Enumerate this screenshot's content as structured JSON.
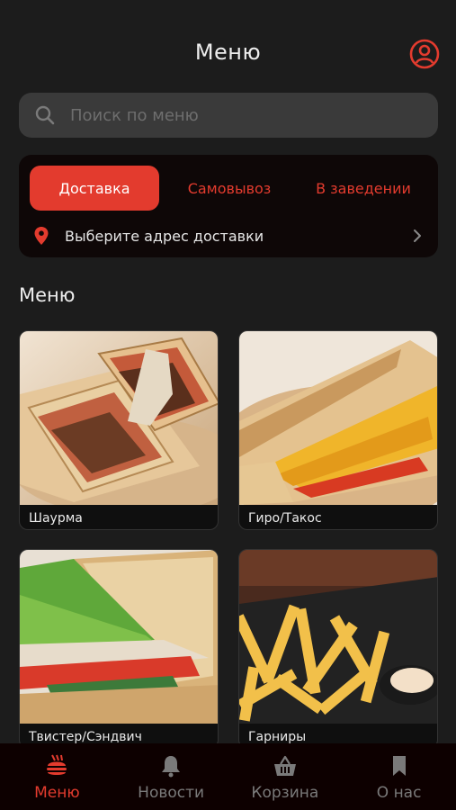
{
  "header": {
    "title": "Меню",
    "profile_icon": "user-circle-icon"
  },
  "search": {
    "placeholder": "Поиск по меню",
    "icon": "search-icon"
  },
  "order_modes": {
    "tabs": [
      {
        "label": "Доставка",
        "active": true
      },
      {
        "label": "Самовывоз",
        "active": false
      },
      {
        "label": "В заведении",
        "active": false
      }
    ],
    "address_prompt": "Выберите адрес доставки"
  },
  "menu": {
    "title": "Меню",
    "categories": [
      {
        "label": "Шаурма"
      },
      {
        "label": "Гиро/Такос"
      },
      {
        "label": "Твистер/Сэндвич"
      },
      {
        "label": "Гарниры"
      }
    ]
  },
  "bottom_nav": {
    "items": [
      {
        "label": "Меню",
        "icon": "burger-menu-icon",
        "active": true
      },
      {
        "label": "Новости",
        "icon": "bell-icon",
        "active": false
      },
      {
        "label": "Корзина",
        "icon": "basket-icon",
        "active": false
      },
      {
        "label": "О нас",
        "icon": "bookmark-icon",
        "active": false
      }
    ]
  },
  "colors": {
    "accent": "#e33b2e",
    "background": "#1c1c1c",
    "card": "#0e0707",
    "nav": "#0d0000"
  }
}
